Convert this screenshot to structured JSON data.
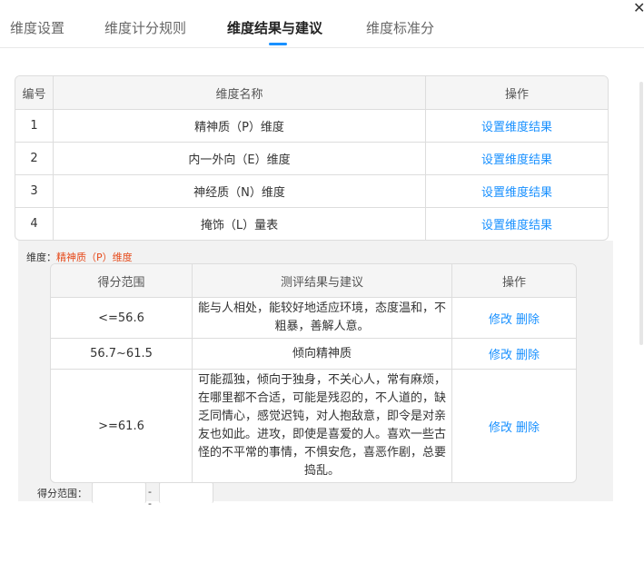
{
  "tabs": [
    "维度设置",
    "维度计分规则",
    "维度结果与建议",
    "维度标准分"
  ],
  "close_icon": "close-icon",
  "dimension_table": {
    "headers": [
      "编号",
      "维度名称",
      "操作"
    ],
    "rows": [
      {
        "no": "1",
        "name": "精神质（P）维度",
        "action": "设置维度结果"
      },
      {
        "no": "2",
        "name": "内一外向（E）维度",
        "action": "设置维度结果"
      },
      {
        "no": "3",
        "name": "神经质（N）维度",
        "action": "设置维度结果"
      },
      {
        "no": "4",
        "name": "掩饰（L）量表",
        "action": "设置维度结果"
      }
    ]
  },
  "result_panel": {
    "dimension_label": "维度：",
    "dimension_value": "精神质（P）维度",
    "headers": [
      "得分范围",
      "测评结果与建议",
      "操作"
    ],
    "rows": [
      {
        "range": "<=56.6",
        "advice": "能与人相处，能较好地适应环境，态度温和，不粗暴，善解人意。",
        "edit": "修改",
        "delete": "删除"
      },
      {
        "range": "56.7~61.5",
        "advice": "倾向精神质",
        "edit": "修改",
        "delete": "删除"
      },
      {
        "range": ">=61.6",
        "advice": "可能孤独，倾向于独身，不关心人，常有麻烦，在哪里都不合适，可能是残忍的，不人道的，缺乏同情心，感觉迟钝，对人抱敌意，即令是对亲友也如此。进攻，即使是喜爱的人。喜欢一些古怪的不平常的事情，不惧安危，喜恶作剧，总要捣乱。",
        "edit": "修改",
        "delete": "删除"
      }
    ],
    "range_label": "得分范围：",
    "range_separator": "--"
  },
  "colors": {
    "accent": "#1890ff",
    "highlight": "#e64b1c"
  }
}
